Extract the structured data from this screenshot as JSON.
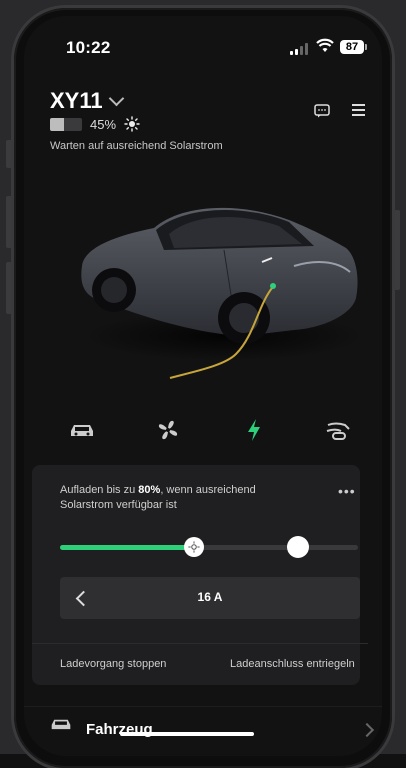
{
  "status_bar": {
    "time": "10:22",
    "battery_level": "87"
  },
  "vehicle": {
    "name": "XY11",
    "battery_percent_text": "45%",
    "battery_fraction": 0.45,
    "status": "Warten auf ausreichend Solarstrom"
  },
  "icons": {
    "messages": "message-icon",
    "menu": "hamburger-menu-icon",
    "solar": "sun-icon",
    "quick_controls": [
      "car-icon",
      "fan-icon",
      "bolt-icon",
      "charge-port-icon"
    ]
  },
  "charging": {
    "description_prefix": "Aufladen bis zu ",
    "limit_text": "80%",
    "description_suffix": ", wenn ausreichend Solarstrom verfügbar ist",
    "current_level_fraction": 0.45,
    "limit_fraction": 0.8,
    "amperage": "16 A",
    "stop_label": "Ladevorgang stoppen",
    "unlock_label": "Ladeanschluss entriegeln",
    "more_label": "•••"
  },
  "nav": {
    "vehicle_label": "Fahrzeug"
  },
  "colors": {
    "accent_green": "#2fd07a",
    "background": "#121213",
    "panel": "#1f1f21"
  }
}
